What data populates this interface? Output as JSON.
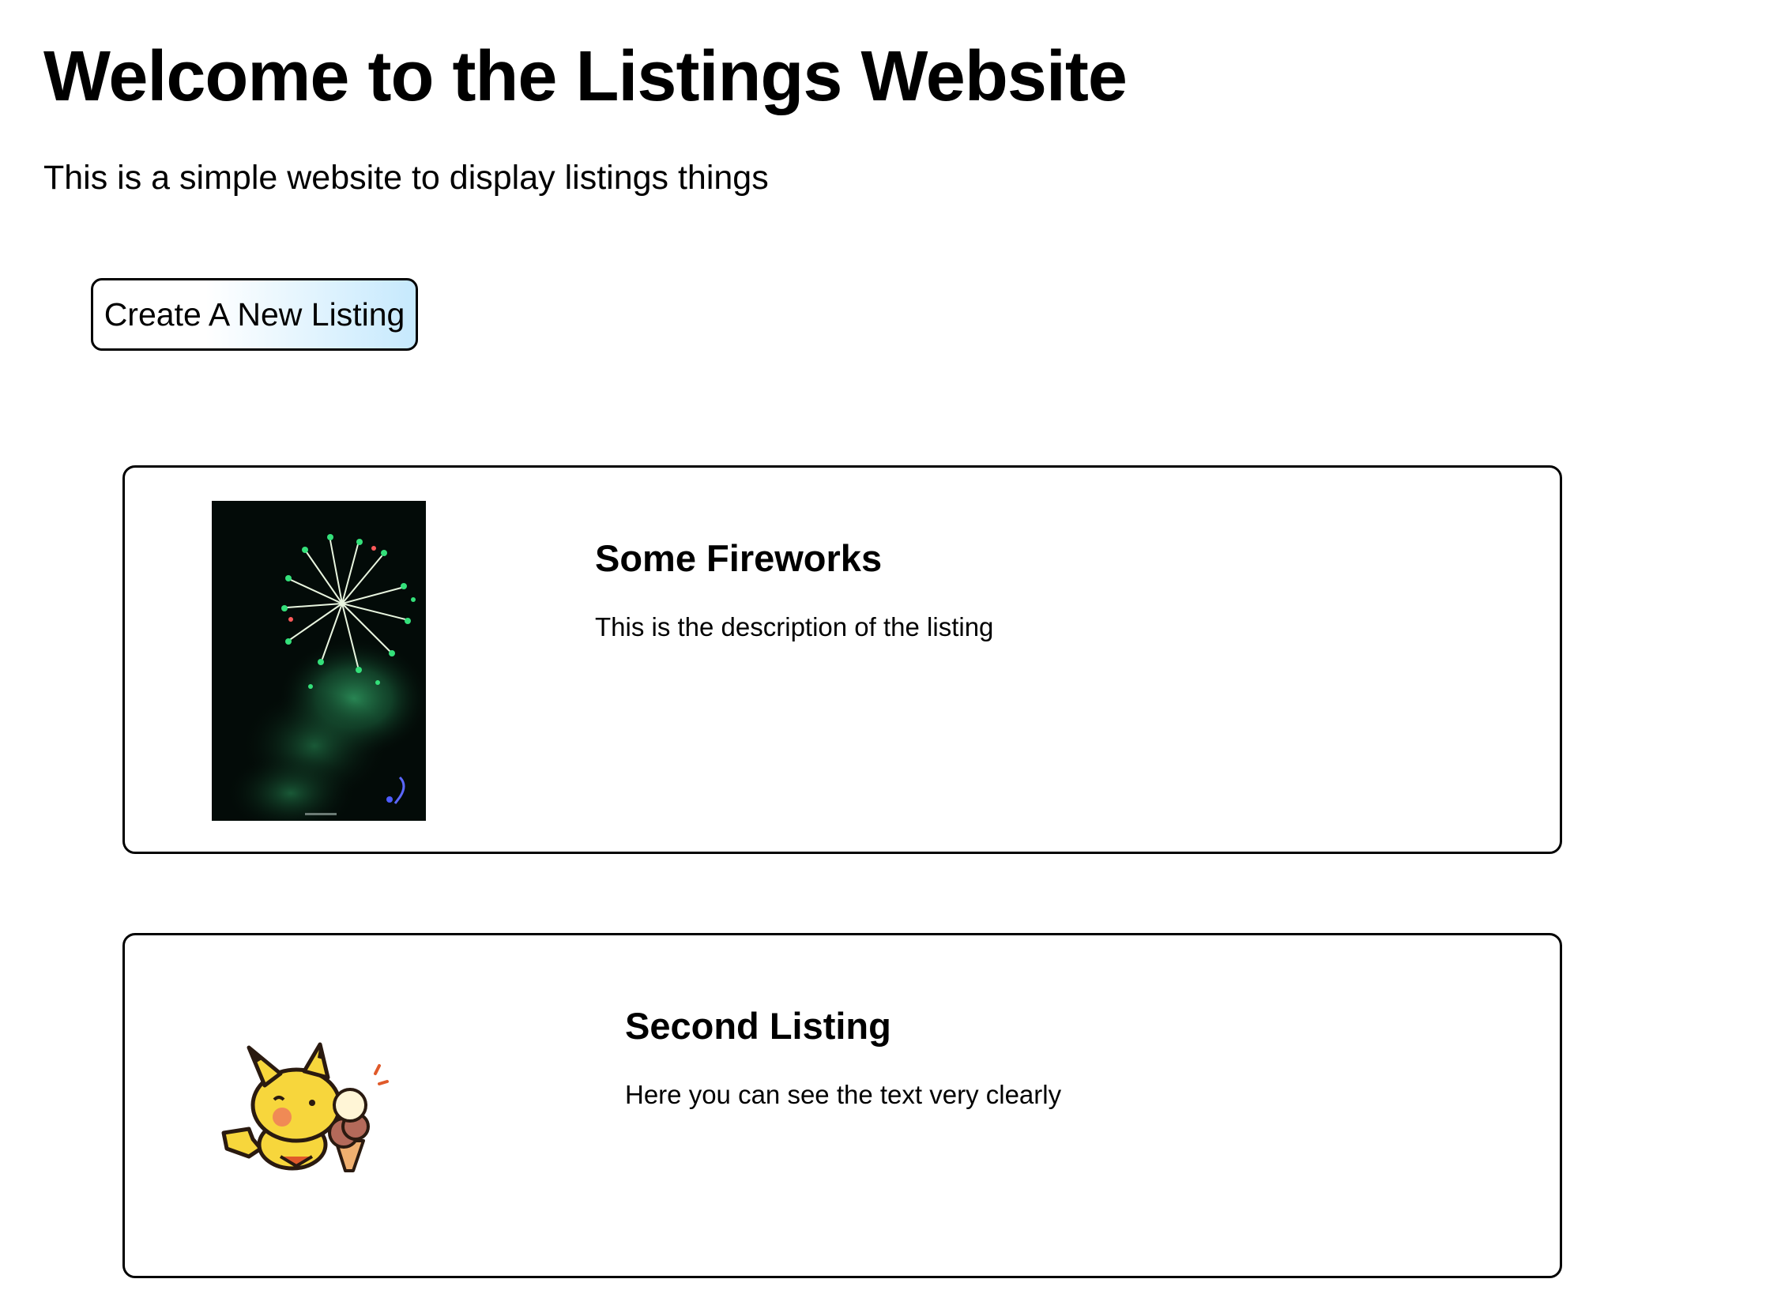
{
  "header": {
    "title": "Welcome to the Listings Website",
    "subtitle": "This is a simple website to display listings things"
  },
  "actions": {
    "create_label": "Create A New Listing"
  },
  "listings": [
    {
      "title": "Some Fireworks",
      "description": "This is the description of the listing",
      "image": "fireworks-photo"
    },
    {
      "title": "Second Listing",
      "description": "Here you can see the text very clearly",
      "image": "pikachu-ice-cream-sticker"
    }
  ]
}
